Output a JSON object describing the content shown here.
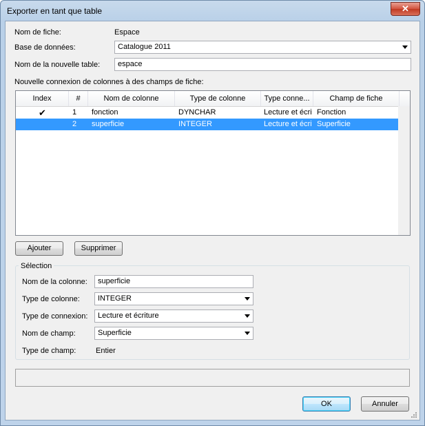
{
  "window": {
    "title": "Exporter en tant que table",
    "close_glyph": "✕"
  },
  "form": {
    "sheet_name_label": "Nom de fiche:",
    "sheet_name_value": "Espace",
    "database_label": "Base de données:",
    "database_value": "Catalogue 2011",
    "new_table_label": "Nom de la nouvelle table:",
    "new_table_value": "espace",
    "connection_label": "Nouvelle connexion de colonnes à des champs de fiche:"
  },
  "table": {
    "columns": [
      "Index",
      "#",
      "Nom de colonne",
      "Type de colonne",
      "Type conne...",
      "Champ de fiche"
    ],
    "rows": [
      {
        "index": "✔",
        "num": "1",
        "name": "fonction",
        "type": "DYNCHAR",
        "conn": "Lecture et écrit",
        "field": "Fonction",
        "selected": false
      },
      {
        "index": "",
        "num": "2",
        "name": "superficie",
        "type": "INTEGER",
        "conn": "Lecture et écrit",
        "field": "Superficie",
        "selected": true
      }
    ]
  },
  "buttons": {
    "add": "Ajouter",
    "delete": "Supprimer",
    "ok": "OK",
    "cancel": "Annuler"
  },
  "selection": {
    "title": "Sélection",
    "column_name_label": "Nom de la colonne:",
    "column_name_value": "superficie",
    "column_type_label": "Type de colonne:",
    "column_type_value": "INTEGER",
    "connection_type_label": "Type de connexion:",
    "connection_type_value": "Lecture et écriture",
    "field_name_label": "Nom de champ:",
    "field_name_value": "Superficie",
    "field_type_label": "Type de champ:",
    "field_type_value": "Entier"
  },
  "colors": {
    "selection": "#3399ff",
    "title_bar": "#bed3ea",
    "close_button": "#c03a22"
  }
}
